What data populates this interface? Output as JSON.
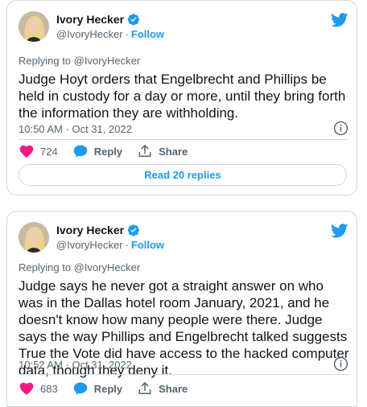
{
  "tweets": [
    {
      "author_name": "Ivory Hecker",
      "handle": "@IvoryHecker",
      "separator": "·",
      "follow_label": "Follow",
      "replying_to": "Replying to @IvoryHecker",
      "text": "Judge Hoyt orders that Engelbrecht and Phillips be held in custody for a day or more, until they bring forth the information they are withholding.",
      "timestamp": "10:50 AM · Oct 31, 2022",
      "likes": "724",
      "reply_label": "Reply",
      "share_label": "Share",
      "read_replies_label": "Read 20 replies"
    },
    {
      "author_name": "Ivory Hecker",
      "handle": "@IvoryHecker",
      "separator": "·",
      "follow_label": "Follow",
      "replying_to": "Replying to @IvoryHecker",
      "text": "Judge says he never got a straight answer on who was in the Dallas hotel room January, 2021, and he doesn't know how many people were there. Judge says the way Phillips and Engelbrecht talked suggests True the Vote did have access to the hacked computer data, though they deny it.",
      "timestamp": "10:52 AM · Oct 31, 2022",
      "likes": "683",
      "reply_label": "Reply",
      "share_label": "Share"
    }
  ],
  "colors": {
    "accent": "#1d9bf0",
    "like": "#f91880",
    "muted": "#536471",
    "border": "#cfd9de"
  },
  "icons": [
    "avatar",
    "verified-badge-icon",
    "twitter-bird-icon",
    "info-icon",
    "heart-icon",
    "reply-bubble-icon",
    "share-icon"
  ]
}
